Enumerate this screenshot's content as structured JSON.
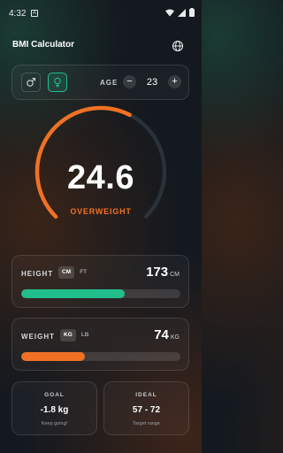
{
  "status_bar": {
    "time": "4:32",
    "notification_glyph": "A",
    "icons": [
      "wifi-icon",
      "signal-icon",
      "battery-icon"
    ]
  },
  "header": {
    "title": "BMI Calculator",
    "language_icon": "globe-icon"
  },
  "profile": {
    "gender_options": [
      {
        "icon": "male-icon",
        "symbol": "♂",
        "selected": false
      },
      {
        "icon": "female-icon",
        "symbol": "♀",
        "selected": true
      }
    ],
    "age_label": "AGE",
    "age_value": "23",
    "decrement_symbol": "−",
    "increment_symbol": "+"
  },
  "result": {
    "bmi": "24.6",
    "status": "OVERWEIGHT",
    "gauge_fraction": 0.6
  },
  "height": {
    "label": "HEIGHT",
    "units": [
      {
        "label": "CM",
        "active": true
      },
      {
        "label": "FT",
        "active": false
      }
    ],
    "value": "173",
    "unit": "CM",
    "fill_fraction": 0.65
  },
  "weight": {
    "label": "WEIGHT",
    "units": [
      {
        "label": "KG",
        "active": true
      },
      {
        "label": "LB",
        "active": false
      }
    ],
    "value": "74",
    "unit": "KG",
    "fill_fraction": 0.4
  },
  "goal": {
    "label": "GOAL",
    "value": "-1.8 kg",
    "caption": "Keep going!"
  },
  "ideal": {
    "label": "IDEAL",
    "value": "57 - 72",
    "caption": "Target range"
  },
  "colors": {
    "accent_green": "#21be8c",
    "accent_orange": "#f07124",
    "background": "#14191f"
  }
}
